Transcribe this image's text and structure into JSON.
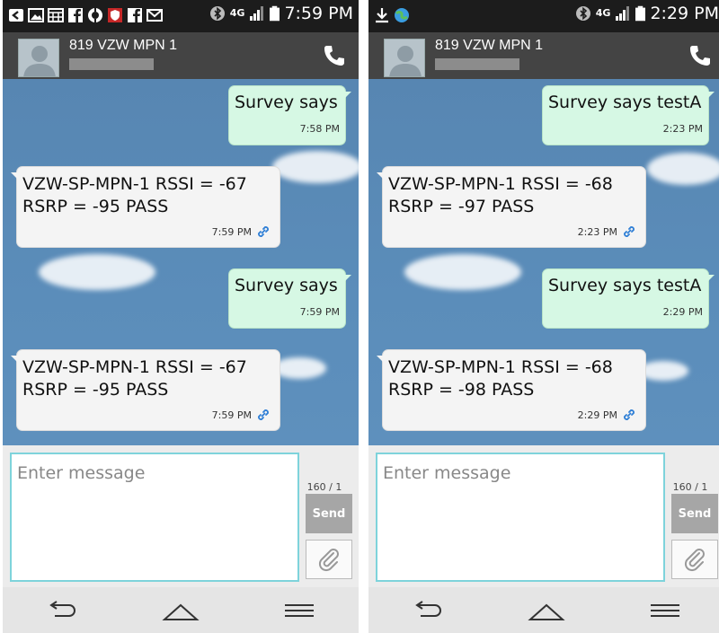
{
  "screens": [
    {
      "status": {
        "time": "7:59 PM",
        "network": "4G"
      },
      "contact": {
        "name": "819 VZW MPN 1"
      },
      "messages": [
        {
          "dir": "out",
          "text": "Survey says",
          "time": "7:58 PM"
        },
        {
          "dir": "in",
          "text": "VZW-SP-MPN-1 RSSI = -67\nRSRP = -95  PASS",
          "time": "7:59 PM"
        },
        {
          "dir": "out",
          "text": "Survey says",
          "time": "7:59 PM"
        },
        {
          "dir": "in",
          "text": "VZW-SP-MPN-1 RSSI = -67\nRSRP = -95  PASS",
          "time": "7:59 PM"
        }
      ],
      "composer": {
        "placeholder": "Enter message",
        "counter": "160 / 1",
        "send_label": "Send"
      }
    },
    {
      "status": {
        "time": "2:29 PM",
        "network": "4G"
      },
      "contact": {
        "name": "819 VZW MPN 1"
      },
      "messages": [
        {
          "dir": "out",
          "text": "Survey says testA",
          "time": "2:23 PM"
        },
        {
          "dir": "in",
          "text": "VZW-SP-MPN-1 RSSI = -68\nRSRP = -97  PASS",
          "time": "2:23 PM"
        },
        {
          "dir": "out",
          "text": "Survey says testA",
          "time": "2:29 PM"
        },
        {
          "dir": "in",
          "text": "VZW-SP-MPN-1 RSSI = -68\nRSRP = -98  PASS",
          "time": "2:29 PM"
        }
      ],
      "composer": {
        "placeholder": "Enter message",
        "counter": "160 / 1",
        "send_label": "Send"
      }
    }
  ],
  "colors": {
    "outgoing_bubble": "#d6f8e4",
    "incoming_bubble": "#f4f4f4",
    "input_border": "#7ed3db",
    "send_button": "#a6a6a6",
    "header": "#444444"
  },
  "icons": {
    "status_left_a": [
      "back-icon",
      "gallery-icon",
      "calendar-icon",
      "facebook-icon",
      "app-icon",
      "shield-icon",
      "facebook-icon",
      "mail-icon"
    ],
    "status_left_b": [
      "download-icon",
      "globe-icon"
    ],
    "call": "phone-icon",
    "attach": "paperclip-icon",
    "nav": [
      "back-icon",
      "home-icon",
      "menu-icon"
    ]
  }
}
